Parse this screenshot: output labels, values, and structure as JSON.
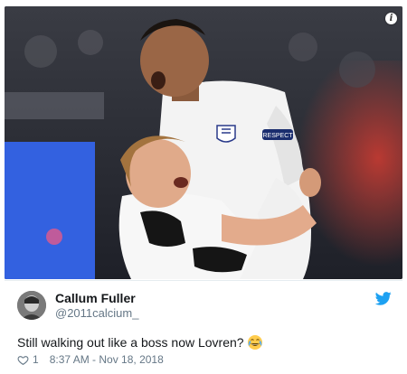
{
  "tweet": {
    "author_name": "Callum Fuller",
    "author_handle": "@2011calcium_",
    "text": "Still walking out like a boss now Lovren?",
    "emoji": "face-with-tears-of-joy-icon",
    "likes": "1",
    "timestamp": "8:37 AM - Nov 18, 2018"
  },
  "media": {
    "sleeve_sponsor": "RESPECT",
    "info_icon": "info-icon"
  },
  "colors": {
    "twitter_blue": "#1da1f2",
    "handle_gray": "#657786",
    "text_dark": "#14171a",
    "heart_gray": "#657786"
  }
}
